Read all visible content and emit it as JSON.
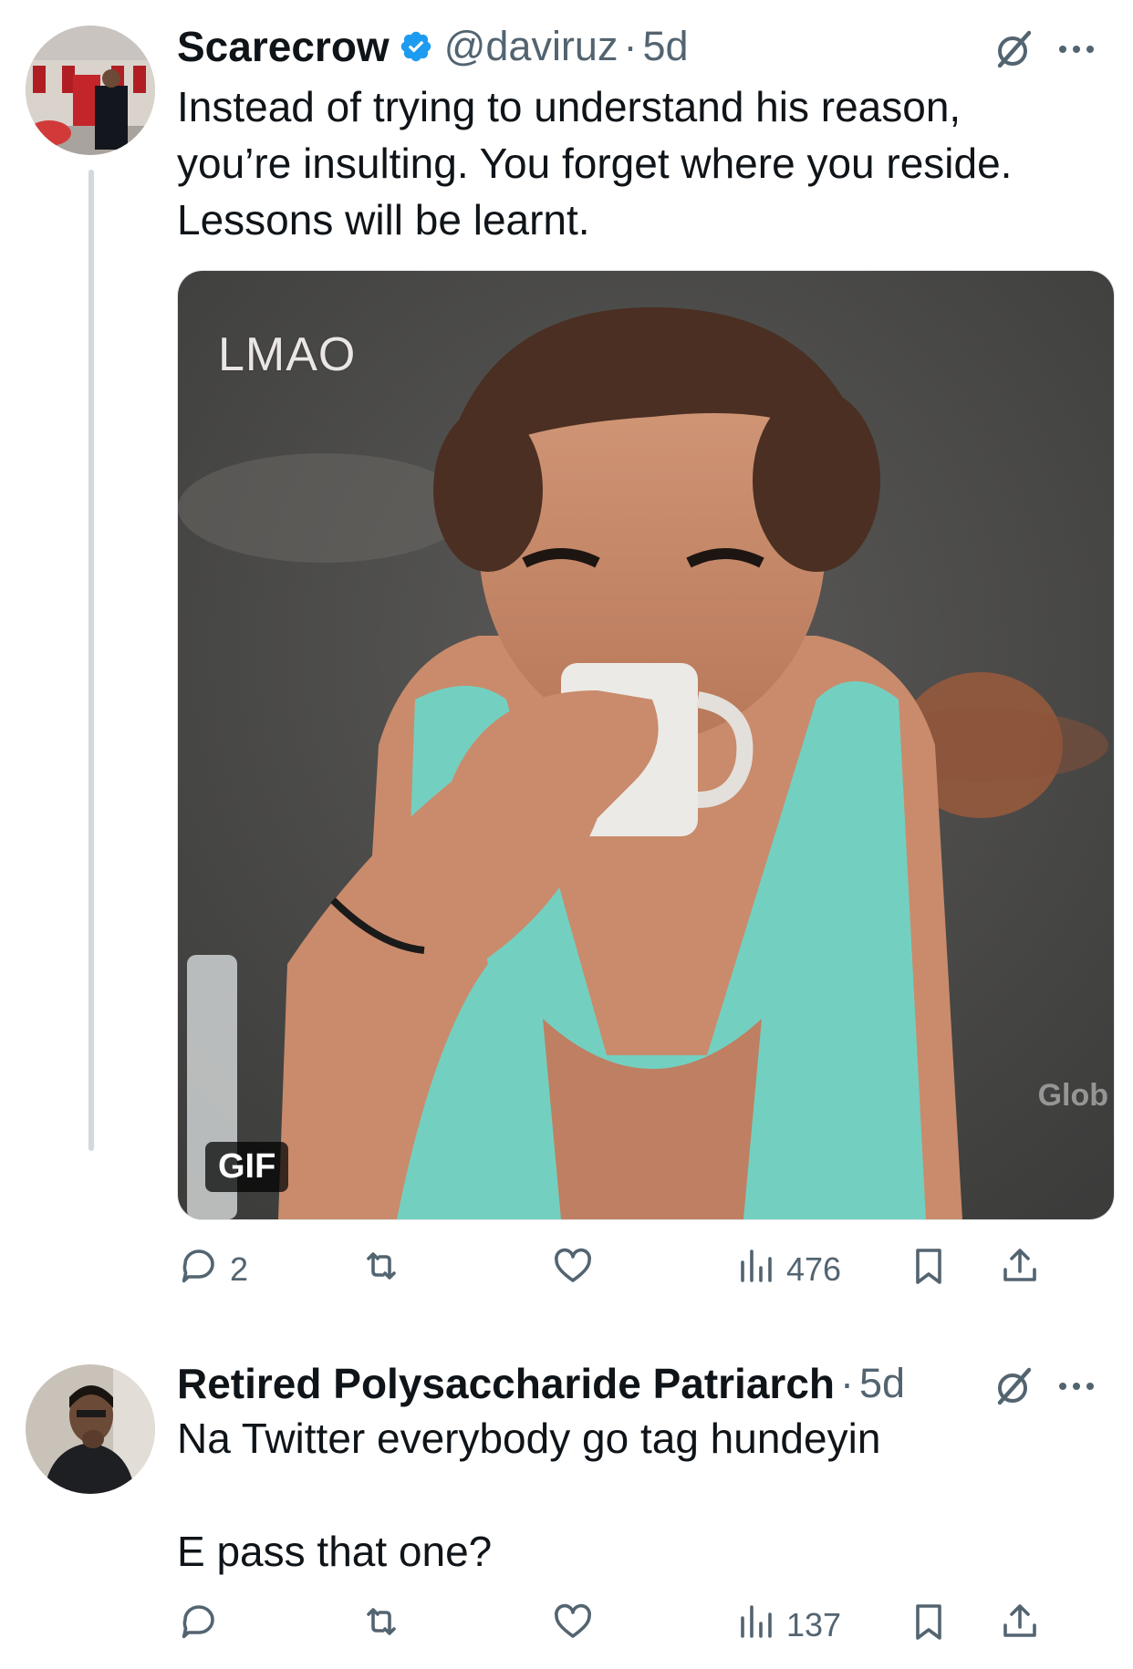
{
  "tweets": [
    {
      "display_name": "Scarecrow",
      "verified": true,
      "handle": "@daviruz",
      "separator": "·",
      "time": "5d",
      "text": "Instead of trying to understand his reason,\nyou’re insulting. You forget where you reside.\nLessons will be learnt.",
      "media": {
        "type": "gif",
        "overlay_text": "LMAO",
        "badge": "GIF",
        "watermark": "Glob"
      },
      "stats": {
        "replies": "2",
        "retweets": "",
        "likes": "",
        "views": "476"
      }
    },
    {
      "display_name": "Retired Polysaccharide Patriarch",
      "verified": false,
      "separator": "·",
      "time": "5d",
      "text": "Na Twitter everybody go tag hundeyin\n\nE pass that one?",
      "stats": {
        "replies": "",
        "retweets": "",
        "likes": "",
        "views": "137"
      }
    }
  ],
  "colors": {
    "text": "#0f1419",
    "secondary": "#536471",
    "verified": "#1d9bf0",
    "thread_line": "#cfd9de"
  },
  "icons": [
    "verified-badge-icon",
    "grok-icon",
    "more-icon",
    "reply-icon",
    "retweet-icon",
    "like-icon",
    "views-icon",
    "bookmark-icon",
    "share-icon"
  ]
}
